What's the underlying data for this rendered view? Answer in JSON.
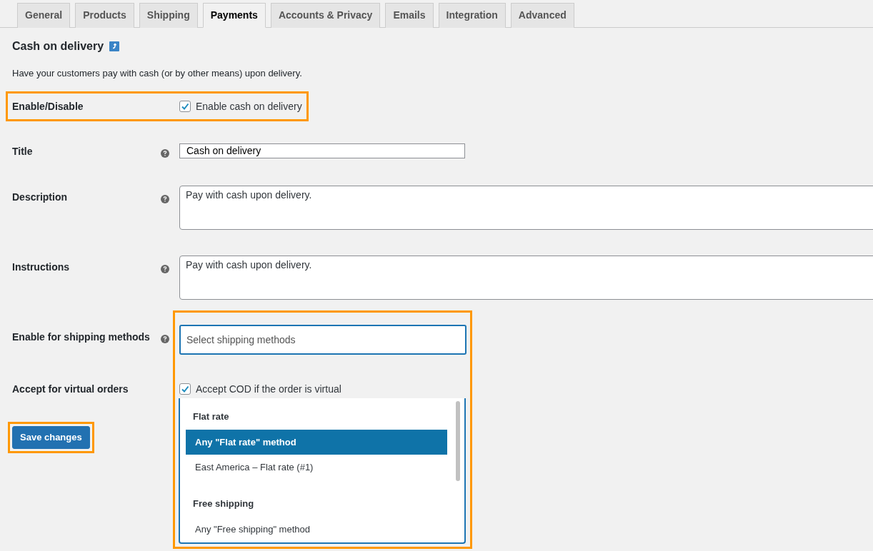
{
  "tabs": [
    {
      "label": "General",
      "selected": false
    },
    {
      "label": "Products",
      "selected": false
    },
    {
      "label": "Shipping",
      "selected": false
    },
    {
      "label": "Payments",
      "selected": true
    },
    {
      "label": "Accounts & Privacy",
      "selected": false
    },
    {
      "label": "Emails",
      "selected": false
    },
    {
      "label": "Integration",
      "selected": false
    },
    {
      "label": "Advanced",
      "selected": false
    }
  ],
  "section": {
    "title": "Cash on delivery",
    "description": "Have your customers pay with cash (or by other means) upon delivery."
  },
  "fields": [
    {
      "kind": "checkbox",
      "label": "Enable/Disable",
      "help": false,
      "highlighted": true,
      "checked": true,
      "text": "Enable cash on delivery"
    },
    {
      "kind": "text",
      "label": "Title",
      "help": true,
      "highlighted": false,
      "value": "Cash on delivery"
    },
    {
      "kind": "textarea",
      "label": "Description",
      "help": true,
      "highlighted": false,
      "value": "Pay with cash upon delivery."
    },
    {
      "kind": "textarea",
      "label": "Instructions",
      "help": true,
      "highlighted": false,
      "value": "Pay with cash upon delivery."
    },
    {
      "kind": "select",
      "label": "Enable for shipping methods",
      "help": true,
      "highlighted": false,
      "placeholder": "Select shipping methods"
    },
    {
      "kind": "checkbox",
      "label": "Accept for virtual orders",
      "help": false,
      "highlighted": false,
      "checked": true,
      "text": "Accept COD if the order is virtual"
    }
  ],
  "dropdown": {
    "highlighted": true,
    "groups": [
      {
        "label": "Flat rate",
        "options": [
          {
            "label": "Any \"Flat rate\" method",
            "selected": true
          },
          {
            "label": "East America – Flat rate (#1)",
            "selected": false
          }
        ]
      },
      {
        "label": "Free shipping",
        "options": [
          {
            "label": "Any \"Free shipping\" method",
            "selected": false
          }
        ]
      }
    ]
  },
  "save_button": {
    "label": "Save changes",
    "highlighted": true
  }
}
